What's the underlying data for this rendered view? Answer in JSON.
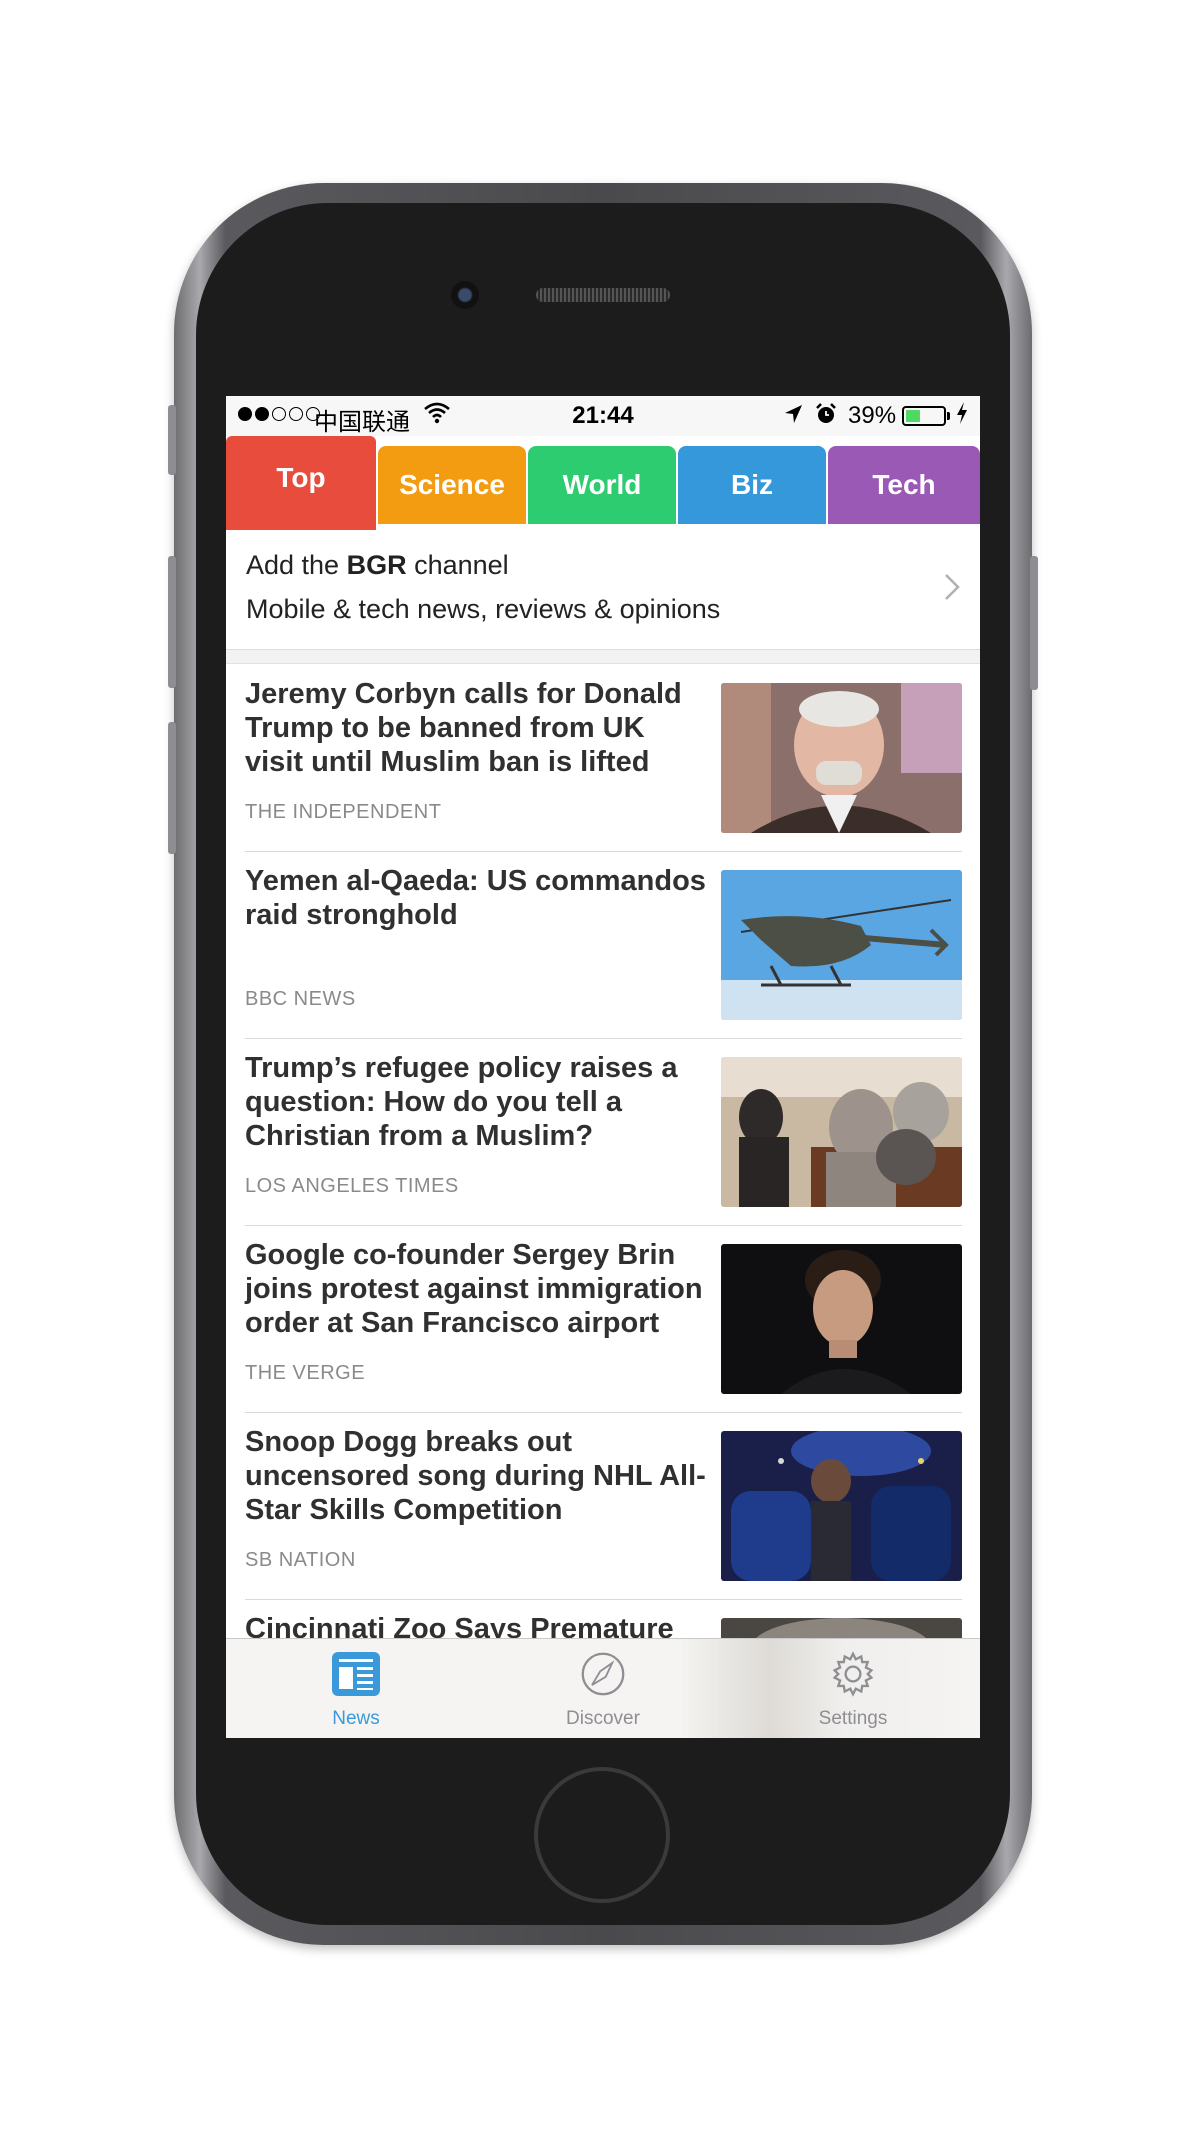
{
  "status_bar": {
    "carrier": "中国联通",
    "time": "21:44",
    "battery_percent": "39%",
    "battery_level": 0.39
  },
  "tabs": [
    {
      "label": "Top",
      "color": "#e74c3c",
      "active": true
    },
    {
      "label": "Science",
      "color": "#f39c12",
      "active": false
    },
    {
      "label": "World",
      "color": "#2ecc71",
      "active": false
    },
    {
      "label": "Biz",
      "color": "#3498db",
      "active": false
    },
    {
      "label": "Tech",
      "color": "#9b59b6",
      "active": false
    }
  ],
  "channel": {
    "prefix": "Add the ",
    "name": "BGR",
    "suffix": " channel",
    "description": "Mobile & tech news, reviews & opinions"
  },
  "articles": [
    {
      "headline": "Jeremy Corbyn calls for Donald Trump to be banned from UK visit until Muslim ban is lifted",
      "source": "THE INDEPENDENT",
      "thumb_icon": "portrait-photo"
    },
    {
      "headline": "Yemen al-Qaeda: US commandos raid stronghold",
      "source": "BBC NEWS",
      "thumb_icon": "helicopter-photo"
    },
    {
      "headline": "Trump’s refugee policy raises a question: How do you tell a Christian from a Muslim?",
      "source": "LOS ANGELES TIMES",
      "thumb_icon": "church-photo"
    },
    {
      "headline": "Google co-founder Sergey Brin joins protest against immigration order at San Francisco airport",
      "source": "THE VERGE",
      "thumb_icon": "portrait-photo"
    },
    {
      "headline": "Snoop Dogg breaks out uncensored song during NHL All-Star Skills Competition",
      "source": "SB NATION",
      "thumb_icon": "hockey-photo"
    },
    {
      "headline": "Cincinnati Zoo Says Premature",
      "source": "",
      "thumb_icon": "photo"
    }
  ],
  "tabbar": {
    "items": [
      {
        "label": "News",
        "icon": "news-icon",
        "active": true
      },
      {
        "label": "Discover",
        "icon": "compass-icon",
        "active": false
      },
      {
        "label": "Settings",
        "icon": "gear-icon",
        "active": false
      }
    ],
    "active_color": "#3a9ad9",
    "inactive_color": "#8e8e93"
  }
}
